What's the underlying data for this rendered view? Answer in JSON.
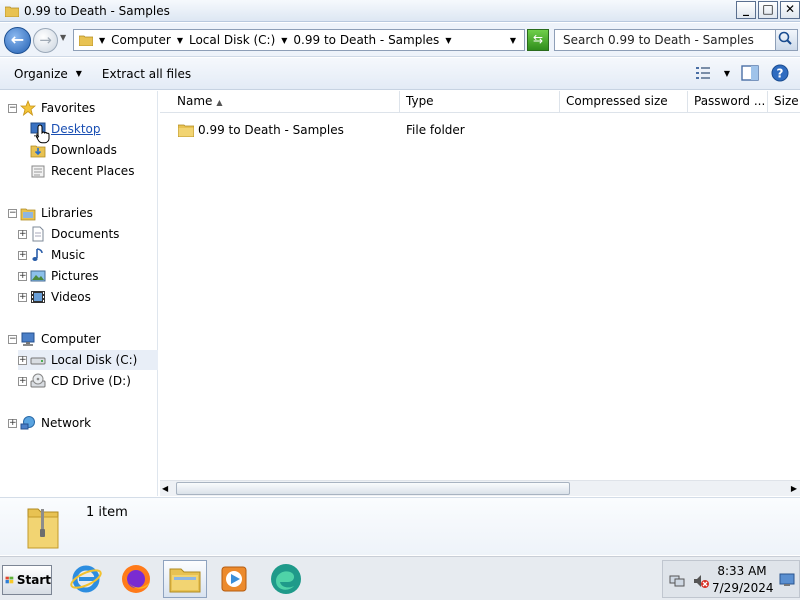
{
  "window": {
    "title": "0.99 to Death - Samples",
    "buttons": {
      "minimize": "_",
      "maximize": "□",
      "close": "✕"
    }
  },
  "address": {
    "crumbs": [
      "Computer",
      "Local Disk (C:)",
      "0.99 to Death - Samples"
    ],
    "search_placeholder": "Search 0.99 to Death - Samples"
  },
  "toolbar": {
    "organize": "Organize",
    "extract": "Extract all files"
  },
  "nav": {
    "favorites": {
      "label": "Favorites",
      "items": [
        "Desktop",
        "Downloads",
        "Recent Places"
      ]
    },
    "libraries": {
      "label": "Libraries",
      "items": [
        "Documents",
        "Music",
        "Pictures",
        "Videos"
      ]
    },
    "computer": {
      "label": "Computer",
      "items": [
        "Local Disk (C:)",
        "CD Drive (D:)"
      ]
    },
    "network": {
      "label": "Network"
    }
  },
  "columns": [
    "Name",
    "Type",
    "Compressed size",
    "Password ...",
    "Size"
  ],
  "files": [
    {
      "name": "0.99 to Death - Samples",
      "type": "File folder"
    }
  ],
  "details": {
    "count": "1 item"
  },
  "taskbar": {
    "start": "Start",
    "apps": [
      "internet-explorer-icon",
      "firefox-icon",
      "file-explorer-icon",
      "media-player-icon",
      "edge-icon"
    ],
    "time": "8:33 AM",
    "date": "7/29/2024"
  }
}
